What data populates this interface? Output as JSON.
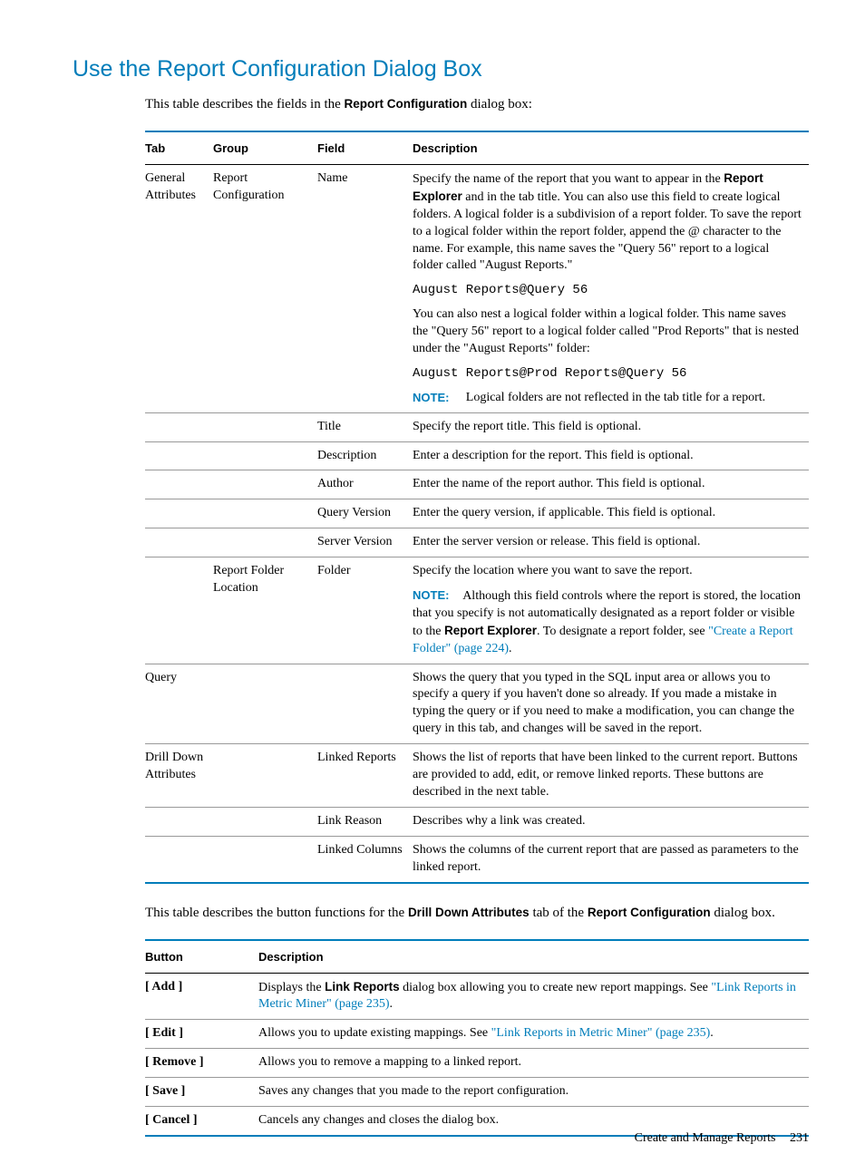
{
  "heading": "Use the Report Configuration Dialog Box",
  "intro_pre": "This table describes the fields in the ",
  "intro_bold": "Report Configuration",
  "intro_post": " dialog box:",
  "table1": {
    "headers": {
      "tab": "Tab",
      "group": "Group",
      "field": "Field",
      "desc": "Description"
    },
    "tabs": {
      "general": "General Attributes",
      "drill": "Drill Down Attributes"
    },
    "groups": {
      "rc": "Report Configuration",
      "rfl": "Report Folder Location"
    },
    "name": {
      "field": "Name",
      "p1a": "Specify the name of the report that you want to appear in the ",
      "p1b": "Report Explorer",
      "p1c": " and in the tab title. You can also use this field to create logical folders. A logical folder is a subdivision of a report folder. To save the report to a logical folder within the report folder, append the @ character to the name. For example, this name saves the \"Query 56\" report to a logical folder called \"August Reports.\"",
      "code1": "August Reports@Query 56",
      "p2": "You can also nest a logical folder within a logical folder. This name saves the \"Query 56\" report to a logical folder called \"Prod Reports\" that is nested under the \"August Reports\" folder:",
      "code2": "August Reports@Prod Reports@Query 56",
      "note_label": "NOTE:",
      "note_text": "Logical folders are not reflected in the tab title for a report."
    },
    "title": {
      "field": "Title",
      "desc": "Specify the report title. This field is optional."
    },
    "descr": {
      "field": "Description",
      "desc": "Enter a description for the report. This field is optional."
    },
    "author": {
      "field": "Author",
      "desc": "Enter the name of the report author. This field is optional."
    },
    "qver": {
      "field": "Query Version",
      "desc": "Enter the query version, if applicable. This field is optional."
    },
    "sver": {
      "field": "Server Version",
      "desc": "Enter the server version or release. This field is optional."
    },
    "folder": {
      "field": "Folder",
      "p1": "Specify the location where you want to save the report.",
      "note_label": "NOTE:",
      "note_a": "Although this field controls where the report is stored, the location that you specify is not automatically designated as a report folder or visible to the ",
      "note_bold": "Report Explorer",
      "note_b": ". To designate a report folder, see ",
      "note_link": "\"Create a Report Folder\" (page 224)",
      "note_c": "."
    },
    "query": {
      "tab": "Query",
      "desc": "Shows the query that you typed in the SQL input area or allows you to specify a query if you haven't done so already. If you made a mistake in typing the query or if you need to make a modification, you can change the query in this tab, and changes will be saved in the report."
    },
    "linked_reports": {
      "field": "Linked Reports",
      "desc": "Shows the list of reports that have been linked to the current report. Buttons are provided to add, edit, or remove linked reports. These buttons are described in the next table."
    },
    "link_reason": {
      "field": "Link Reason",
      "desc": "Describes why a link was created."
    },
    "linked_cols": {
      "field": "Linked Columns",
      "desc": "Shows the columns of the current report that are passed as parameters to the linked report."
    }
  },
  "mid_para": {
    "a": "This table describes the button functions for the ",
    "b": "Drill Down Attributes",
    "c": " tab of the ",
    "d": "Report Configuration",
    "e": " dialog box."
  },
  "table2": {
    "headers": {
      "button": "Button",
      "desc": "Description"
    },
    "rows": {
      "add": {
        "btn": "[ Add ]",
        "a": "Displays the ",
        "b": "Link Reports",
        "c": " dialog box allowing you to create new report mappings. See ",
        "link": "\"Link Reports in Metric Miner\" (page 235)",
        "d": "."
      },
      "edit": {
        "btn": "[ Edit ]",
        "a": "Allows you to update existing mappings. See ",
        "link": "\"Link Reports in Metric Miner\" (page 235)",
        "b": "."
      },
      "remove": {
        "btn": "[ Remove ]",
        "desc": "Allows you to remove a mapping to a linked report."
      },
      "save": {
        "btn": "[ Save ]",
        "desc": "Saves any changes that you made to the report configuration."
      },
      "cancel": {
        "btn": "[ Cancel ]",
        "desc": "Cancels any changes and closes the dialog box."
      }
    }
  },
  "footer": {
    "text": "Create and Manage Reports",
    "page": "231"
  }
}
